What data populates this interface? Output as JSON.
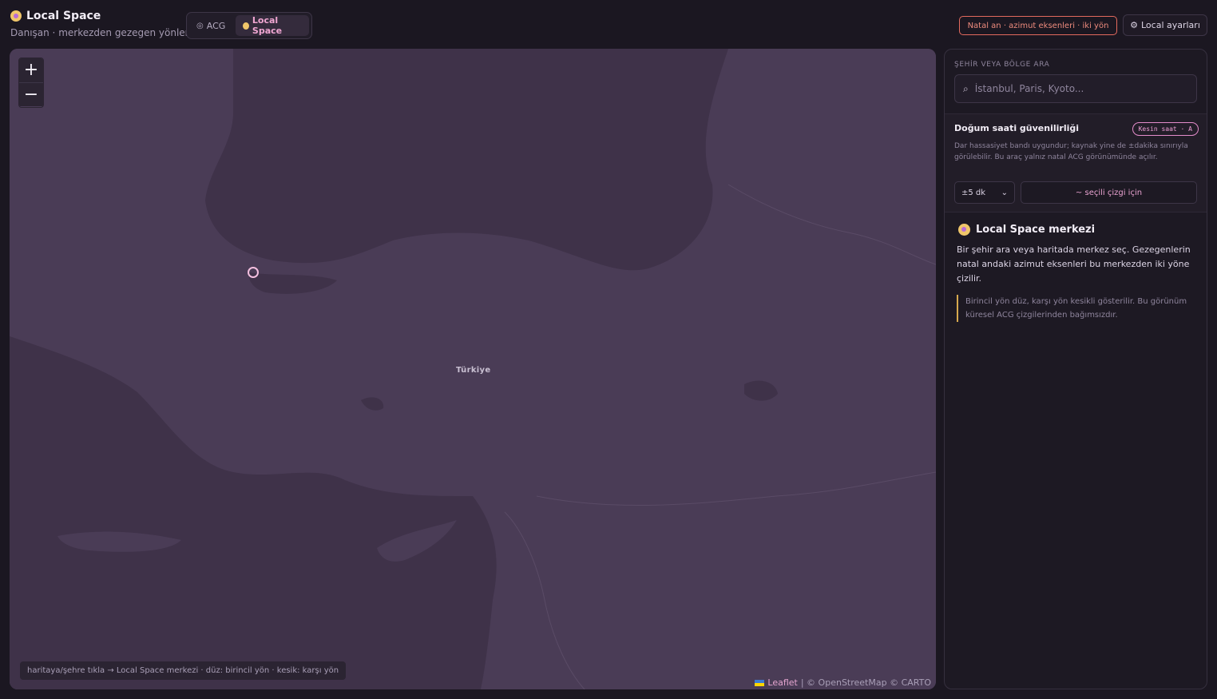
{
  "header": {
    "title": "Local Space",
    "subtitle": "Danışan · merkezden gezegen yönleri",
    "modes": [
      {
        "label": "ACG",
        "icon": "target-icon",
        "active": false
      },
      {
        "label": "Local Space",
        "icon": "sun-icon",
        "active": true
      }
    ],
    "natal_badge": "Natal an · azimut eksenleri · iki yön",
    "settings_label": "Local ayarları"
  },
  "map": {
    "zoom_in": "+",
    "zoom_out": "−",
    "country_label": "Türkiye",
    "hint": "haritaya/şehre tıkla → Local Space merkezi · düz: birincil yön · kesik: karşı yön",
    "attribution_link": "Leaflet",
    "attribution_text": "| © OpenStreetMap © CARTO"
  },
  "panel": {
    "search_label": "ŞEHİR VEYA BÖLGE ARA",
    "search_placeholder": "İstanbul, Paris, Kyoto...",
    "reliability": {
      "title": "Doğum saati güvenilirliği",
      "pill": "Kesin saat · A",
      "description": "Dar hassasiyet bandı uygundur; kaynak yine de ±dakika sınırıyla görülebilir. Bu araç yalnız natal ACG görünümünde açılır.",
      "precision_value": "±5 dk",
      "line_button": "~ seçili çizgi için"
    },
    "center": {
      "title": "Local Space merkezi",
      "description": "Bir şehir ara veya haritada merkez seç. Gezegenlerin natal andaki azimut eksenleri bu merkezden iki yöne çizilir.",
      "note": "Birincil yön düz, karşı yön kesikli gösterilir. Bu görünüm küresel ACG çizgilerinden bağımsızdır."
    }
  },
  "colors": {
    "background": "#1b1721",
    "map_land": "#4a3c56",
    "map_water": "#3f3249",
    "accent_pink": "#f0a6d2",
    "accent_red": "#e36a5e",
    "accent_gold": "#d7a94e"
  }
}
